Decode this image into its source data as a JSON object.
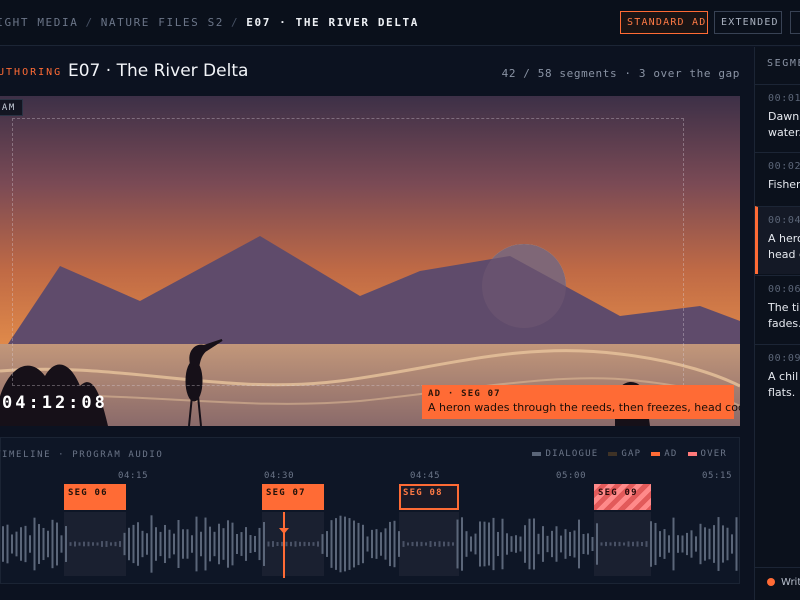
{
  "breadcrumb": {
    "items": [
      "LIGHT MEDIA",
      "NATURE FILES S2"
    ],
    "current": "E07 · THE RIVER DELTA"
  },
  "topbar": {
    "standard_ad": "STANDARD AD",
    "extended": "EXTENDED"
  },
  "header": {
    "mode": "AUTHORING",
    "title": "E07 · The River Delta",
    "stats": "42 / 58 segments · 3 over the gap"
  },
  "video": {
    "cam_tag": "CAM",
    "timecode": "04:12:08",
    "caption": {
      "head": "AD · SEG 07",
      "text": "A heron wades through the reeds, then freezes, head cocked."
    }
  },
  "timeline": {
    "label": "TIMELINE · PROGRAM AUDIO",
    "legend": [
      "DIALOGUE",
      "GAP",
      "AD",
      "OVER"
    ],
    "ticks": [
      "04:15",
      "04:30",
      "04:45",
      "05:00",
      "05:15"
    ],
    "segments": [
      "SEG 06",
      "SEG 07",
      "SEG 08",
      "SEG 09"
    ]
  },
  "panel": {
    "title": "SEGMENTS",
    "items": [
      {
        "time": "00:01",
        "text": [
          "Dawn",
          "water."
        ]
      },
      {
        "time": "00:02",
        "text": [
          "Fisher"
        ]
      },
      {
        "time": "00:04",
        "text": [
          "A hero",
          "head c"
        ]
      },
      {
        "time": "00:06",
        "text": [
          "The ti",
          "fades."
        ]
      },
      {
        "time": "00:09",
        "text": [
          "A chil",
          "flats."
        ]
      }
    ],
    "footer": "Writing"
  },
  "colors": {
    "accent": "#ff6b35",
    "over": "#ff7a7a",
    "background": "#0c1220"
  },
  "icons": {
    "playhead": "playhead-marker-icon",
    "status_dot": "status-dot-icon"
  }
}
